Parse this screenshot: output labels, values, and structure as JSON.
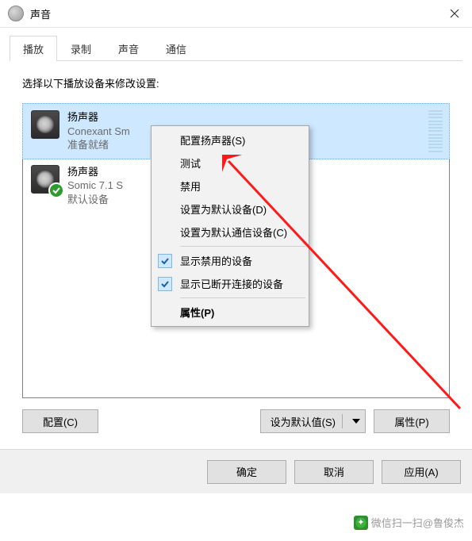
{
  "titlebar": {
    "title": "声音"
  },
  "tabs": [
    {
      "label": "播放"
    },
    {
      "label": "录制"
    },
    {
      "label": "声音"
    },
    {
      "label": "通信"
    }
  ],
  "instruction": "选择以下播放设备来修改设置:",
  "devices": [
    {
      "name": "扬声器",
      "sub": "Conexant Sm",
      "status": "准备就绪"
    },
    {
      "name": "扬声器",
      "sub": "Somic 7.1 S",
      "status": "默认设备"
    }
  ],
  "context_menu": {
    "configure": "配置扬声器(S)",
    "test": "测试",
    "disable": "禁用",
    "set_default_device": "设置为默认设备(D)",
    "set_default_comm": "设置为默认通信设备(C)",
    "show_disabled": "显示禁用的设备",
    "show_disconnected": "显示已断开连接的设备",
    "properties": "属性(P)"
  },
  "panel_buttons": {
    "configure": "配置(C)",
    "set_default": "设为默认值(S)",
    "properties": "属性(P)"
  },
  "dialog_buttons": {
    "ok": "确定",
    "cancel": "取消",
    "apply": "应用(A)"
  },
  "watermark": "微信扫一扫@鲁俊杰"
}
